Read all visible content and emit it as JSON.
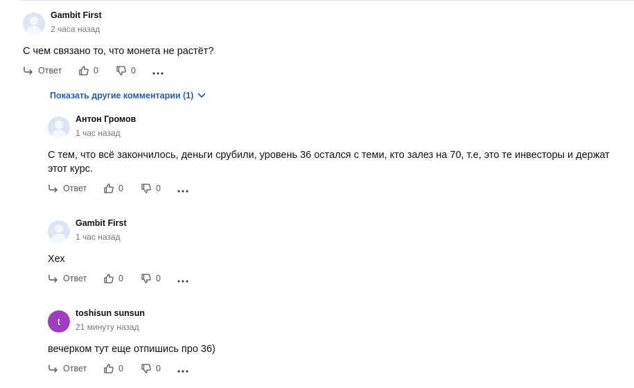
{
  "actions": {
    "reply_label": "Ответ"
  },
  "show_more": {
    "label": "Показать другие комментарии (1)"
  },
  "comments": [
    {
      "author": "Gambit First",
      "time": "2 часа назад",
      "text": "С чем связано то, что монета не растёт?",
      "likes": "0",
      "dislikes": "0",
      "avatar": "placeholder"
    },
    {
      "author": "Антон Громов",
      "time": "1 час назад",
      "text": "С тем, что всё закончилось, деньги срубили, уровень 36 остался с теми, кто залез на 70, т.е, это те инвесторы и держат этот курс.",
      "likes": "0",
      "dislikes": "0",
      "avatar": "placeholder"
    },
    {
      "author": "Gambit First",
      "time": "1 час назад",
      "text": "Хех",
      "likes": "0",
      "dislikes": "0",
      "avatar": "placeholder"
    },
    {
      "author": "toshisun sunsun",
      "time": "21 минуту назад",
      "text": "вечерком тут еще отпишись про 36)",
      "likes": "0",
      "dislikes": "0",
      "avatar": "t",
      "avatar_color": "#9c3fbf"
    }
  ]
}
